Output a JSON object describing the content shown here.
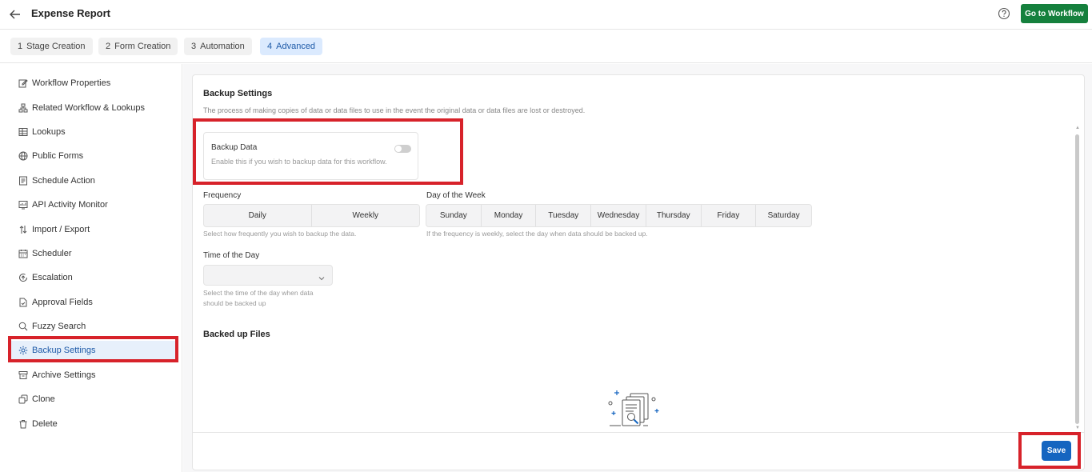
{
  "header": {
    "title": "Expense Report",
    "go_button": "Go to Workflow"
  },
  "steps": [
    {
      "num": "1",
      "label": "Stage Creation"
    },
    {
      "num": "2",
      "label": "Form Creation"
    },
    {
      "num": "3",
      "label": "Automation"
    },
    {
      "num": "4",
      "label": "Advanced"
    }
  ],
  "sidebar": {
    "items": [
      {
        "label": "Workflow Properties",
        "icon": "edit-icon"
      },
      {
        "label": "Related Workflow & Lookups",
        "icon": "hierarchy-icon"
      },
      {
        "label": "Lookups",
        "icon": "table-icon"
      },
      {
        "label": "Public Forms",
        "icon": "globe-icon"
      },
      {
        "label": "Schedule Action",
        "icon": "list-icon"
      },
      {
        "label": "API Activity Monitor",
        "icon": "monitor-icon"
      },
      {
        "label": "Import / Export",
        "icon": "arrows-icon"
      },
      {
        "label": "Scheduler",
        "icon": "calendar-icon"
      },
      {
        "label": "Escalation",
        "icon": "escalation-icon"
      },
      {
        "label": "Approval Fields",
        "icon": "file-check-icon"
      },
      {
        "label": "Fuzzy Search",
        "icon": "search-icon"
      },
      {
        "label": "Backup Settings",
        "icon": "gear-icon"
      },
      {
        "label": "Archive Settings",
        "icon": "archive-icon"
      },
      {
        "label": "Clone",
        "icon": "copy-icon"
      },
      {
        "label": "Delete",
        "icon": "trash-icon"
      }
    ],
    "active": "Backup Settings"
  },
  "main": {
    "title": "Backup Settings",
    "description": "The process of making copies of data or data files to use in the event the original data or data files are lost or destroyed.",
    "backup_card": {
      "title": "Backup Data",
      "description": "Enable this if you wish to backup data for this workflow.",
      "enabled": false
    },
    "frequency": {
      "label": "Frequency",
      "options": [
        "Daily",
        "Weekly"
      ],
      "hint": "Select how frequently you wish to backup the data."
    },
    "day_of_week": {
      "label": "Day of the Week",
      "options": [
        "Sunday",
        "Monday",
        "Tuesday",
        "Wednesday",
        "Thursday",
        "Friday",
        "Saturday"
      ],
      "hint": "If the frequency is weekly, select the day when data should be backed up."
    },
    "time_of_day": {
      "label": "Time of the Day",
      "value": "",
      "hint_line1": "Select the time of the day when data",
      "hint_line2": "should be backed up"
    },
    "backed_up_files": {
      "title": "Backed up Files"
    },
    "save_label": "Save"
  },
  "colors": {
    "go_button": "#15803d",
    "save_button": "#1565c0",
    "active_step_bg": "#dbeafe",
    "active_text": "#1e5aa8",
    "highlight_box": "#d7222a"
  }
}
